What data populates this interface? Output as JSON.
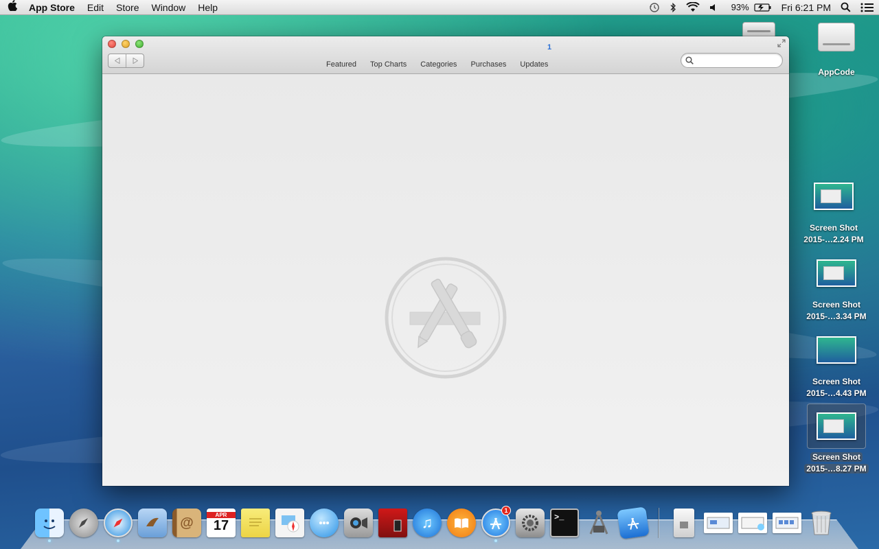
{
  "menubar": {
    "app_name": "App Store",
    "items": [
      "Edit",
      "Store",
      "Window",
      "Help"
    ],
    "battery": "93%",
    "clock": "Fri 6:21 PM"
  },
  "desktop": {
    "drive_label": "AppCode",
    "screenshots": [
      {
        "line1": "Screen Shot",
        "line2": "2015-…2.24 PM"
      },
      {
        "line1": "Screen Shot",
        "line2": "2015-…3.34 PM"
      },
      {
        "line1": "Screen Shot",
        "line2": "2015-…4.43 PM"
      },
      {
        "line1": "Screen Shot",
        "line2": "2015-…8.27 PM"
      }
    ]
  },
  "window": {
    "update_badge": "1",
    "tabs": [
      "Featured",
      "Top Charts",
      "Categories",
      "Purchases",
      "Updates"
    ],
    "search": {
      "value": "",
      "placeholder": ""
    }
  },
  "dock": {
    "app_store_badge": "1",
    "calendar": {
      "month": "APR",
      "day": "17"
    },
    "terminal_prompt": ">_"
  },
  "colors": {
    "desktop_top": "#2fb68f",
    "desktop_bottom": "#1f4f8c",
    "window_bg": "#ececec",
    "badge_red": "#e3261c",
    "accent_blue": "#2a6fd6"
  }
}
